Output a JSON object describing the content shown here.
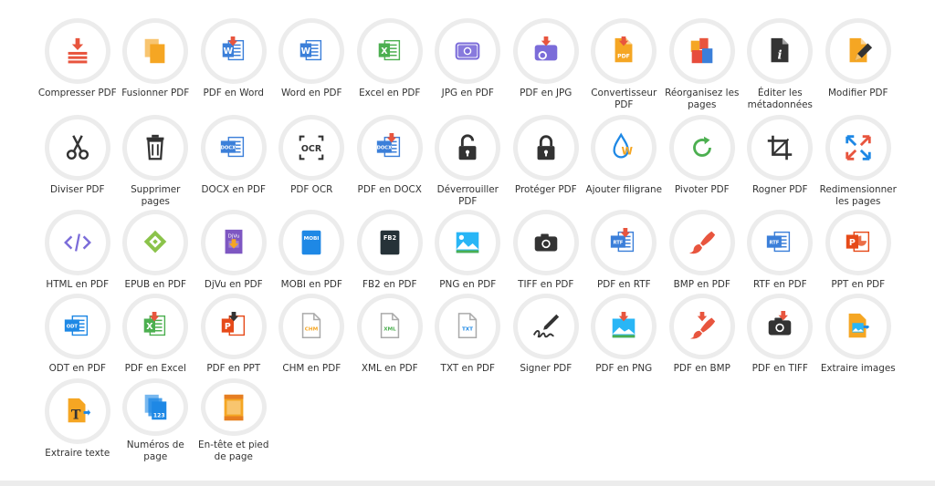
{
  "tools": [
    {
      "label": "Compresser PDF",
      "icon": "compress-icon"
    },
    {
      "label": "Fusionner PDF",
      "icon": "merge-icon"
    },
    {
      "label": "PDF en Word",
      "icon": "pdf-to-word-icon"
    },
    {
      "label": "Word en PDF",
      "icon": "word-icon"
    },
    {
      "label": "Excel en PDF",
      "icon": "excel-icon"
    },
    {
      "label": "JPG en PDF",
      "icon": "camera-icon"
    },
    {
      "label": "PDF en JPG",
      "icon": "pdf-to-jpg-icon"
    },
    {
      "label": "Convertisseur PDF",
      "icon": "pdf-converter-icon"
    },
    {
      "label": "Réorganisez les pages",
      "icon": "reorganize-icon"
    },
    {
      "label": "Éditer les métadonnées",
      "icon": "metadata-icon"
    },
    {
      "label": "Modifier PDF",
      "icon": "edit-pdf-icon"
    },
    {
      "label": "Diviser PDF",
      "icon": "scissors-icon"
    },
    {
      "label": "Supprimer pages",
      "icon": "trash-icon"
    },
    {
      "label": "DOCX en PDF",
      "icon": "docx-icon"
    },
    {
      "label": "PDF OCR",
      "icon": "ocr-icon"
    },
    {
      "label": "PDF en DOCX",
      "icon": "pdf-to-docx-icon"
    },
    {
      "label": "Déverrouiller PDF",
      "icon": "unlock-icon"
    },
    {
      "label": "Protéger PDF",
      "icon": "lock-icon"
    },
    {
      "label": "Ajouter filigrane",
      "icon": "watermark-icon"
    },
    {
      "label": "Pivoter PDF",
      "icon": "rotate-icon"
    },
    {
      "label": "Rogner PDF",
      "icon": "crop-icon"
    },
    {
      "label": "Redimensionner les pages",
      "icon": "resize-icon"
    },
    {
      "label": "HTML en PDF",
      "icon": "html-icon"
    },
    {
      "label": "EPUB en PDF",
      "icon": "epub-icon"
    },
    {
      "label": "DjVu en PDF",
      "icon": "djvu-icon"
    },
    {
      "label": "MOBI en PDF",
      "icon": "mobi-icon"
    },
    {
      "label": "FB2 en PDF",
      "icon": "fb2-icon"
    },
    {
      "label": "PNG en PDF",
      "icon": "png-image-icon"
    },
    {
      "label": "TIFF en PDF",
      "icon": "tiff-camera-icon"
    },
    {
      "label": "PDF en RTF",
      "icon": "pdf-to-rtf-icon"
    },
    {
      "label": "BMP en PDF",
      "icon": "brush-icon"
    },
    {
      "label": "RTF en PDF",
      "icon": "rtf-icon"
    },
    {
      "label": "PPT en PDF",
      "icon": "ppt-icon"
    },
    {
      "label": "ODT en PDF",
      "icon": "odt-icon"
    },
    {
      "label": "PDF en Excel",
      "icon": "pdf-to-excel-icon"
    },
    {
      "label": "PDF en PPT",
      "icon": "pdf-to-ppt-icon"
    },
    {
      "label": "CHM en PDF",
      "icon": "chm-icon"
    },
    {
      "label": "XML en PDF",
      "icon": "xml-icon"
    },
    {
      "label": "TXT en PDF",
      "icon": "txt-icon"
    },
    {
      "label": "Signer PDF",
      "icon": "signature-icon"
    },
    {
      "label": "PDF en PNG",
      "icon": "pdf-to-png-icon"
    },
    {
      "label": "PDF en BMP",
      "icon": "pdf-to-bmp-icon"
    },
    {
      "label": "PDF en TIFF",
      "icon": "pdf-to-tiff-icon"
    },
    {
      "label": "Extraire images",
      "icon": "extract-images-icon"
    },
    {
      "label": "Extraire texte",
      "icon": "extract-text-icon"
    },
    {
      "label": "Numéros de page",
      "icon": "page-numbers-icon"
    },
    {
      "label": "En-tête et pied de page",
      "icon": "header-footer-icon"
    }
  ],
  "icon_text": {
    "docx": "DOCX",
    "ocr": "OCR",
    "djvu": "DjVu",
    "mobi": "MOBI",
    "fb2": "FB2",
    "rtf": "RTF",
    "odt": "ODT",
    "chm": "CHM",
    "xml": "XML",
    "txt": "TXT",
    "pdf": "PDF",
    "num": "123",
    "w": "W",
    "x": "X",
    "p": "P",
    "i": "i"
  },
  "colors": {
    "red": "#e8553e",
    "orange": "#f5a623",
    "blue": "#3b7fd9",
    "green": "#4caf50",
    "purple": "#7b6cd9",
    "dark": "#333333",
    "ring": "#ececec"
  }
}
